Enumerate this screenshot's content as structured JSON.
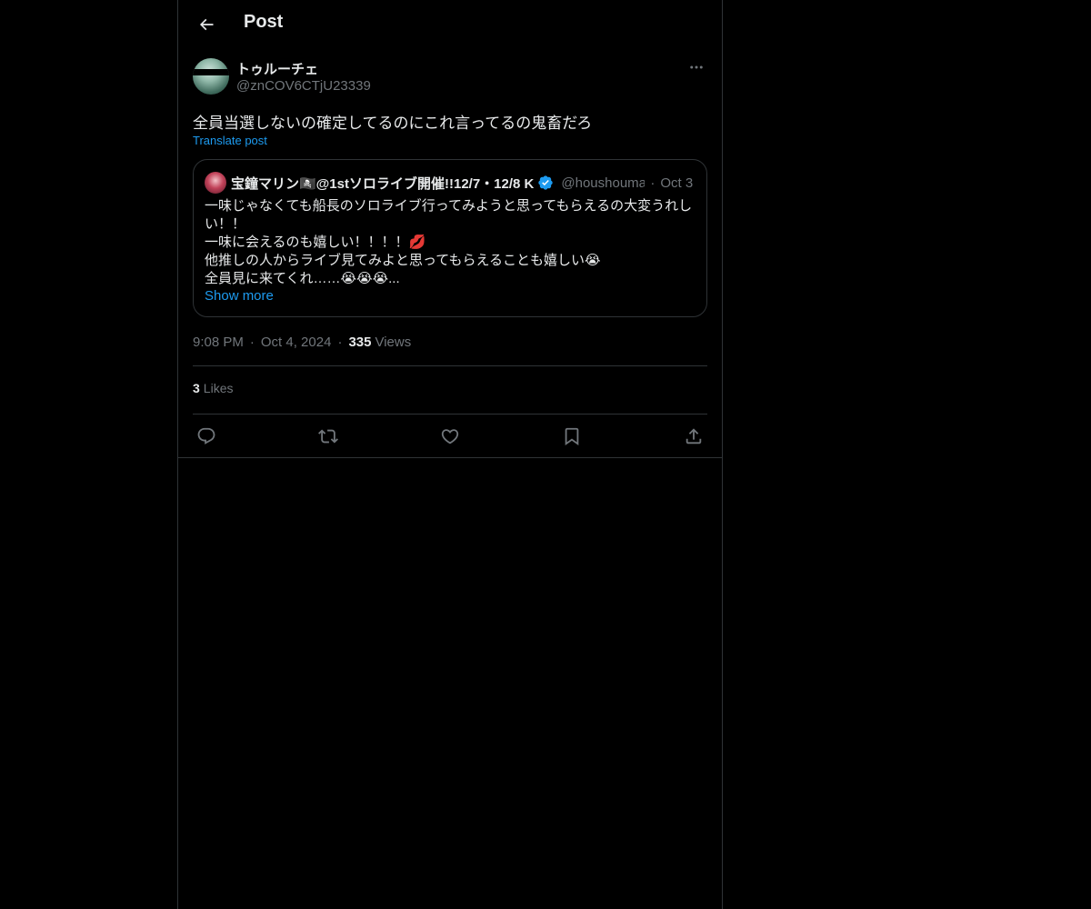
{
  "header": {
    "title": "Post"
  },
  "post": {
    "author": {
      "display_name": "トゥルーチェ",
      "handle": "@znCOV6CTjU23339"
    },
    "text": "全員当選しないの確定してるのにこれ言ってるの鬼畜だろ",
    "translate_label": "Translate post",
    "quote": {
      "display_name": "宝鐘マリン🏴‍☠️@1stソロライブ開催!!12/7・12/8 K",
      "handle": "@houshoumarine",
      "date": "Oct 3",
      "lines": [
        "一味じゃなくても船長のソロライブ行ってみようと思ってもらえるの大変うれし",
        "い！！",
        "一味に会えるのも嬉しい！！！！💋",
        "他推しの人からライブ見てみよと思ってもらえることも嬉しい😭",
        "全員見に来てくれ……😭😭😭..."
      ],
      "show_more": "Show more"
    },
    "time": "9:08 PM",
    "date": "Oct 4, 2024",
    "views_count": "335",
    "views_label": "Views",
    "likes_count": "3",
    "likes_label": "Likes"
  }
}
